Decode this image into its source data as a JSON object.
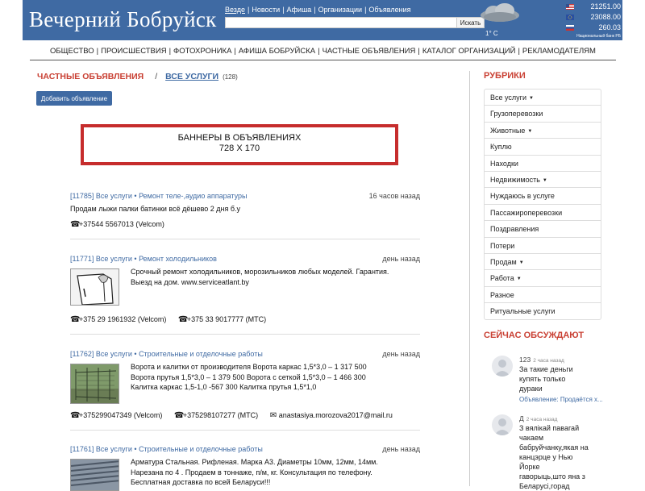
{
  "header": {
    "logo": "Вечерний Бобруйск",
    "top_links": [
      "Везде",
      "Новости",
      "Афиша",
      "Организации",
      "Объявления"
    ],
    "search_placeholder": "",
    "search_button": "Искать",
    "weather_temp": "1° C",
    "rates": [
      {
        "flag": "us-flag-icon",
        "value": "21251.00"
      },
      {
        "flag": "eu-flag-icon",
        "value": "23088.00"
      },
      {
        "flag": "ru-flag-icon",
        "value": "260.03"
      }
    ],
    "rates_source": "Национальный банк РБ"
  },
  "nav": [
    "ОБЩЕСТВО",
    "ПРОИСШЕСТВИЯ",
    "ФОТОХРОНИКА",
    "АФИША БОБРУЙСКА",
    "ЧАСТНЫЕ ОБЪЯВЛЕНИЯ",
    "КАТАЛОГ ОРГАНИЗАЦИЙ",
    "РЕКЛАМОДАТЕЛЯМ"
  ],
  "breadcrumb": {
    "section": "ЧАСТНЫЕ ОБЪЯВЛЕНИЯ",
    "separator": "/",
    "current": "ВСЕ УСЛУГИ",
    "count": "(128)"
  },
  "add_button": "Добавить объявление",
  "banner": {
    "line1": "БАННЕРЫ В ОБЪЯВЛЕНИЯХ",
    "line2": "728 X 170"
  },
  "ads": [
    {
      "id": "[11785]",
      "category": "Все услуги",
      "subcategory": "Ремонт теле-,аудио аппаратуры",
      "time": "16 часов назад",
      "text": [
        "Продам лыжи палки батинки всё дёшево 2 дня б.у"
      ],
      "contacts": [
        "+37544 5567013 (Velcom)"
      ]
    },
    {
      "id": "[11771]",
      "category": "Все услуги",
      "subcategory": "Ремонт холодильников",
      "time": "день назад",
      "text": [
        "Срочный ремонт холодильников, морозильников любых моделей. Гарантия.",
        "Выезд на дом. www.serviceatlant.by"
      ],
      "contacts": [
        "+375 29 1961932 (Velcom)",
        "+375 33 9017777 (МТС)"
      ]
    },
    {
      "id": "[11762]",
      "category": "Все услуги",
      "subcategory": "Строительные и отделочные работы",
      "time": "день назад",
      "text": [
        "Ворота и калитки от производителя Ворота каркас 1,5*3,0 – 1 317 500",
        "Ворота прутья 1,5*3,0 – 1 379 500 Ворота с сеткой 1,5*3,0 – 1 466 300",
        "Калитка каркас 1,5-1,0 -567 300 Калитка прутья 1,5*1,0"
      ],
      "contacts": [
        "+375299047349 (Velcom)",
        "+375298107277 (МТС)",
        "anastasiya.morozova2017@mail.ru"
      ]
    },
    {
      "id": "[11761]",
      "category": "Все услуги",
      "subcategory": "Строительные и отделочные работы",
      "time": "день назад",
      "text": [
        "Арматура Стальная. Рифленая. Марка А3. Диаметры 10мм, 12мм, 14мм.",
        "Нарезана по 4 . Продаем в тоннаже, п/м, кг. Консультация по телефону.",
        "Бесплатная доставка по всей Беларуси!!!"
      ],
      "contacts": []
    }
  ],
  "sidebar": {
    "title": "РУБРИКИ",
    "items": [
      {
        "label": "Все услуги",
        "caret": true
      },
      {
        "label": "Грузоперевозки",
        "caret": false
      },
      {
        "label": "Животные",
        "caret": true
      },
      {
        "label": "Куплю",
        "caret": false
      },
      {
        "label": "Находки",
        "caret": false
      },
      {
        "label": "Недвижимость",
        "caret": true
      },
      {
        "label": "Нуждаюсь в услуге",
        "caret": false
      },
      {
        "label": "Пассажироперевозки",
        "caret": false
      },
      {
        "label": "Поздравления",
        "caret": false
      },
      {
        "label": "Потери",
        "caret": false
      },
      {
        "label": "Продам",
        "caret": true
      },
      {
        "label": "Работа",
        "caret": true
      },
      {
        "label": "Разное",
        "caret": false
      },
      {
        "label": "Ритуальные услуги",
        "caret": false
      }
    ],
    "discuss_title": "СЕЙЧАС ОБСУЖДАЮТ",
    "comments": [
      {
        "author": "123",
        "ago": "2 часа назад",
        "lines": [
          "За такие деньги",
          "купять только",
          "дураки"
        ],
        "link": "Объявление: Продаётся х..."
      },
      {
        "author": "Д",
        "ago": "2 часа назад",
        "lines": [
          "З вялікай павагай",
          "чакаем",
          "бабруйчанку,якая на",
          "канцэрце у Нью",
          "Йорке",
          "гаворыць,што яна з",
          "Беларусі,горад"
        ],
        "link": ""
      }
    ]
  }
}
